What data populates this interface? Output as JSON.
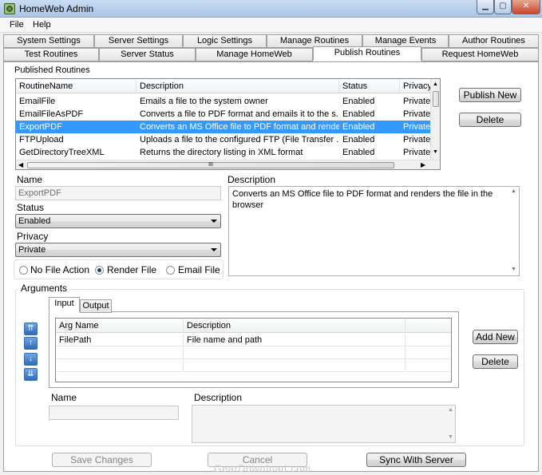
{
  "window": {
    "title": "HomeWeb Admin"
  },
  "menu": {
    "file": "File",
    "help": "Help"
  },
  "tabs_row1": [
    "System Settings",
    "Server Settings",
    "Logic Settings",
    "Manage Routines",
    "Manage Events",
    "Author Routines"
  ],
  "tabs_row2": [
    "Test Routines",
    "Server Status",
    "Manage HomeWeb",
    "Publish Routines",
    "Request HomeWeb"
  ],
  "published": {
    "label": "Published Routines",
    "columns": [
      "RoutineName",
      "Description",
      "Status",
      "Privacy"
    ],
    "rows": [
      [
        "EmailFile",
        "Emails a file to the system owner",
        "Enabled",
        "Private"
      ],
      [
        "EmailFileAsPDF",
        "Converts a file to PDF format and emails it to the s...",
        "Enabled",
        "Private"
      ],
      [
        "ExportPDF",
        "Converts an MS Office file to PDF format and rende...",
        "Enabled",
        "Private"
      ],
      [
        "FTPUpload",
        "Uploads a file to the configured FTP (File Transfer ...",
        "Enabled",
        "Private"
      ],
      [
        "GetDirectoryTreeXML",
        "Returns the directory listing in XML format",
        "Enabled",
        "Private"
      ]
    ],
    "hscroll_grip": "III"
  },
  "buttons": {
    "publish_new": "Publish New",
    "delete": "Delete",
    "add_new": "Add New",
    "delete_arg": "Delete",
    "save": "Save Changes",
    "cancel": "Cancel",
    "sync": "Sync With Server"
  },
  "form": {
    "name_label": "Name",
    "name_value": "ExportPDF",
    "status_label": "Status",
    "status_value": "Enabled",
    "privacy_label": "Privacy",
    "privacy_value": "Private",
    "description_label": "Description",
    "description_value": "Converts an MS Office file to PDF format and renders the file in the browser",
    "radio_none": "No File Action",
    "radio_render": "Render File",
    "radio_email": "Email File"
  },
  "arguments": {
    "label": "Arguments",
    "tab_input": "Input",
    "tab_output": "Output",
    "columns": [
      "Arg Name",
      "Description"
    ],
    "rows": [
      [
        "FilePath",
        "File name and path"
      ]
    ],
    "name_label": "Name",
    "description_label": "Description"
  },
  "watermark": "GearDownload.com"
}
